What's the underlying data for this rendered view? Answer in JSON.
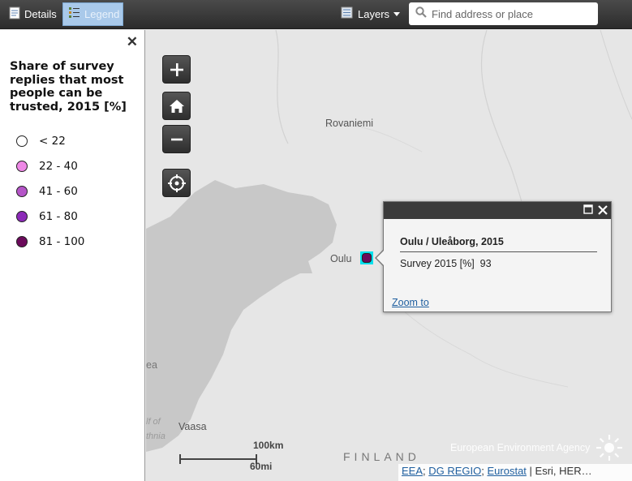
{
  "toolbar": {
    "details_label": "Details",
    "legend_label": "Legend",
    "layers_label": "Layers"
  },
  "search": {
    "placeholder": "Find address or place",
    "value": ""
  },
  "legend": {
    "title": "Share of survey replies that most people can be trusted, 2015 [%]",
    "classes": [
      {
        "label": "< 22",
        "color": "#ffffff"
      },
      {
        "label": "22 - 40",
        "color": "#ee88e6"
      },
      {
        "label": "41 - 60",
        "color": "#b555c8"
      },
      {
        "label": "61 - 80",
        "color": "#8c2ab8"
      },
      {
        "label": "81 - 100",
        "color": "#6b0a5b"
      }
    ]
  },
  "map": {
    "places": {
      "rovaniemi": "Rovaniemi",
      "oulu": "Oulu",
      "vaasa": "Vaasa",
      "finland": "FINLAND",
      "sea_fragment": "ea",
      "gulf_fragment_1": "lf of",
      "gulf_fragment_2": "thnia"
    },
    "zoom_controls": {
      "zoom_in": "+",
      "zoom_out": "−"
    },
    "marker_value_class": "81 - 100",
    "scale": {
      "km_label": "100km",
      "mi_label": "60mi"
    },
    "watermark": "European Environment Agency"
  },
  "popup": {
    "title": "Oulu / Uleåborg, 2015",
    "field_label": "Survey 2015 [%]",
    "field_value": "93",
    "zoom_link": "Zoom to"
  },
  "attribution": {
    "links": [
      "EEA",
      "DG REGIO",
      "Eurostat"
    ],
    "tail": "| Esri, HER…"
  },
  "colors": {
    "toolbar_bg": "#333333",
    "legend_active": "#a9c9ea",
    "marker_fill": "#6b0a5b",
    "marker_highlight": "#00e0ee",
    "water": "#c8c8c8",
    "land": "#e6e6e6"
  }
}
